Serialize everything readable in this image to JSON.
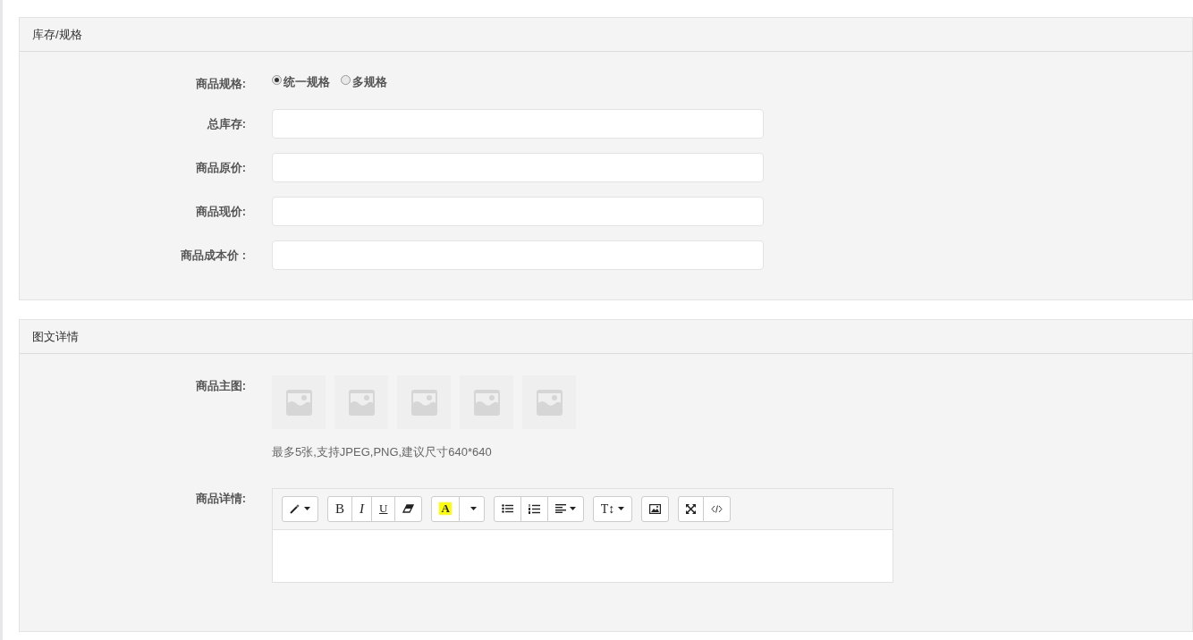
{
  "panels": [
    {
      "title": "库存/规格",
      "fields": [
        {
          "kind": "radio",
          "label": "商品规格:",
          "options": [
            {
              "label": "统一规格",
              "selected": true
            },
            {
              "label": "多规格",
              "selected": false
            }
          ]
        },
        {
          "kind": "input",
          "label": "总库存:"
        },
        {
          "kind": "input",
          "label": "商品原价:"
        },
        {
          "kind": "input",
          "label": "商品现价:"
        },
        {
          "kind": "input",
          "label": "商品成本价 :"
        }
      ]
    },
    {
      "title": "图文详情",
      "fields": [
        {
          "kind": "images",
          "label": "商品主图:",
          "slots": [
            {
              "kind": "empty"
            },
            {
              "kind": "empty"
            },
            {
              "kind": "empty"
            },
            {
              "kind": "empty"
            },
            {
              "kind": "empty"
            }
          ],
          "hint": "最多5张,支持JPEG,PNG,建议尺寸640*640"
        },
        {
          "kind": "editor",
          "label": "商品详情:",
          "toolbar": [
            [
              {
                "kind": "magic",
                "caret": true
              }
            ],
            [
              {
                "kind": "bold",
                "label": "B"
              },
              {
                "kind": "italic",
                "label": "I"
              },
              {
                "kind": "underline",
                "label": "U"
              },
              {
                "kind": "eraser"
              }
            ],
            [
              {
                "kind": "highlight",
                "label": "A"
              },
              {
                "kind": "caret"
              }
            ],
            [
              {
                "kind": "ul"
              },
              {
                "kind": "ol"
              },
              {
                "kind": "align",
                "caret": true
              }
            ],
            [
              {
                "kind": "fontsize",
                "label": "T↕",
                "caret": true
              }
            ],
            [
              {
                "kind": "picture"
              }
            ],
            [
              {
                "kind": "fullscreen"
              },
              {
                "kind": "code"
              }
            ]
          ]
        }
      ]
    }
  ]
}
